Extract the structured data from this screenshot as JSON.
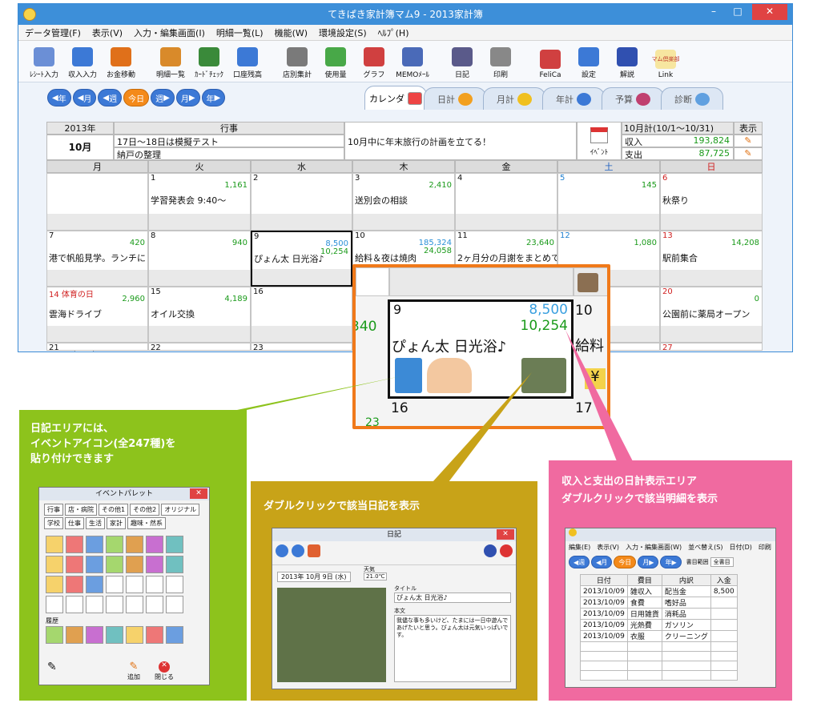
{
  "window": {
    "title": "てきぱき家計簿マム9 - 2013家計簿",
    "min": "–",
    "max": "□",
    "close": "✕"
  },
  "menu": [
    "データ管理(F)",
    "表示(V)",
    "入力・編集画面(I)",
    "明細一覧(L)",
    "機能(W)",
    "環境設定(S)",
    "ﾍﾙﾌﾟ(H)"
  ],
  "toolbar": [
    {
      "label": "ﾚｼｰﾄ入力",
      "icon": "receipt-icon",
      "color": "#6b8fd6"
    },
    {
      "label": "収入入力",
      "icon": "income-icon",
      "color": "#3c79d6"
    },
    {
      "label": "お金移動",
      "icon": "money-move-icon",
      "color": "#e0701a"
    },
    {
      "label": "明細一覧",
      "icon": "list-icon",
      "color": "#d98a2a"
    },
    {
      "label": "ｶｰﾄﾞﾁｪｯｸ",
      "icon": "card-icon",
      "color": "#3a8a3a"
    },
    {
      "label": "口座残高",
      "icon": "bank-icon",
      "color": "#3c79d6"
    },
    {
      "label": "店別集計",
      "icon": "shop-icon",
      "color": "#7a7a7a"
    },
    {
      "label": "使用量",
      "icon": "usage-icon",
      "color": "#48a848"
    },
    {
      "label": "グラフ",
      "icon": "graph-icon",
      "color": "#d04040"
    },
    {
      "label": "MEMOﾒｰﾙ",
      "icon": "memo-icon",
      "color": "#4a6ab8"
    },
    {
      "label": "日記",
      "icon": "diary-icon",
      "color": "#5a5a8a"
    },
    {
      "label": "印刷",
      "icon": "print-icon",
      "color": "#888888"
    },
    {
      "label": "FeliCa",
      "icon": "felica-icon",
      "color": "#d04040"
    },
    {
      "label": "設定",
      "icon": "settings-icon",
      "color": "#3c79d6"
    },
    {
      "label": "解説",
      "icon": "help-icon",
      "color": "#3050b0"
    },
    {
      "label": "Link",
      "icon": "link-icon",
      "color": "#c09020"
    }
  ],
  "toolbar_link_logo": "マム倶楽部",
  "nav": {
    "year_prev": "年",
    "month_prev": "月",
    "week_prev": "週",
    "today": "今日",
    "week_next": "週",
    "month_next": "月",
    "year_next": "年"
  },
  "view_tabs": [
    "カレンダ",
    "日計",
    "月計",
    "年計",
    "予算",
    "診断"
  ],
  "header": {
    "year": "2013年",
    "month": "10月",
    "events_title": "行事",
    "event1": "17日〜18日は模擬テスト",
    "event2": "納戸の整理",
    "memo": "10月中に年末旅行の計画を立てる！",
    "event_button": "ｲﾍﾞﾝﾄ",
    "summary_title": "10月計(10/1〜10/31)",
    "display_label": "表示",
    "income_label": "収入",
    "income_value": "193,824",
    "expense_label": "支出",
    "expense_value": "87,725"
  },
  "weekdays": [
    "月",
    "火",
    "水",
    "木",
    "金",
    "土",
    "日"
  ],
  "weeks": [
    [
      {
        "num": "",
        "a1": "",
        "a2": "",
        "ev": ""
      },
      {
        "num": "1",
        "a1": "1,161",
        "a2": "",
        "ev": "学習発表会 9:40〜"
      },
      {
        "num": "2",
        "a1": "",
        "a2": "",
        "ev": ""
      },
      {
        "num": "3",
        "a1": "2,410",
        "a2": "",
        "ev": "送別会の相談"
      },
      {
        "num": "4",
        "a1": "",
        "a2": "",
        "ev": ""
      },
      {
        "num": "5",
        "a1": "145",
        "a2": "",
        "ev": ""
      },
      {
        "num": "6",
        "a1": "",
        "a2": "",
        "ev": "秋祭り"
      }
    ],
    [
      {
        "num": "7",
        "a1": "420",
        "a2": "",
        "ev": "港で帆船見学。ランチに"
      },
      {
        "num": "8",
        "a1": "940",
        "a2": "",
        "ev": ""
      },
      {
        "num": "9",
        "a1": "8,500",
        "a2": "10,254",
        "ev": "ぴょん太 日光浴♪"
      },
      {
        "num": "10",
        "a1": "185,324",
        "a2": "24,058",
        "ev": "給料＆夜は焼肉"
      },
      {
        "num": "11",
        "a1": "23,640",
        "a2": "",
        "ev": "2ヶ月分の月謝をまとめて"
      },
      {
        "num": "12",
        "a1": "1,080",
        "a2": "",
        "ev": ""
      },
      {
        "num": "13",
        "a1": "14,208",
        "a2": "",
        "ev": "駅前集合"
      }
    ],
    [
      {
        "num": "14 体育の日",
        "a1": "2,960",
        "a2": "",
        "ev": "雲海ドライブ"
      },
      {
        "num": "15",
        "a1": "4,189",
        "a2": "",
        "ev": "オイル交換"
      },
      {
        "num": "16",
        "a1": "",
        "a2": "",
        "ev": ""
      },
      {
        "num": "17",
        "a1": "",
        "a2": "",
        "ev": ""
      },
      {
        "num": "",
        "a1": "",
        "a2": "",
        "ev": ""
      },
      {
        "num": "",
        "a1": "",
        "a2": "",
        "ev": ""
      },
      {
        "num": "20",
        "a1": "0",
        "a2": "",
        "ev": "公園前に薬局オープン"
      }
    ],
    [
      {
        "num": "21"
      },
      {
        "num": "22"
      },
      {
        "num": "23"
      },
      {
        "num": ""
      },
      {
        "num": ""
      },
      {
        "num": ""
      },
      {
        "num": "27"
      }
    ]
  ],
  "zoom": {
    "day": "9",
    "left_num": "340",
    "v1": "8,500",
    "v2": "10,254",
    "ev": "ぴょん太 日光浴♪",
    "next_day": "10",
    "next_ev": "給料",
    "yen": "¥",
    "below_day": "16",
    "below_right": "17",
    "bottom_left": "23"
  },
  "callouts": {
    "green": "日記エリアには、\nイベントアイコン(全247種)を\n貼り付けできます",
    "olive": "ダブルクリックで該当日記を表示",
    "pink": "収入と支出の日計表示エリア\nダブルクリックで該当明細を表示"
  },
  "palette": {
    "title": "イベントパレット",
    "tabs": [
      "行事",
      "店・病院",
      "その他1",
      "その他2",
      "オリジナル",
      "学校",
      "仕事",
      "生活",
      "家計",
      "趣味・然系"
    ],
    "history": "履歴",
    "add": "追加",
    "close": "閉じる"
  },
  "diary": {
    "title": "日記",
    "date": "2013年 10月 9日 (水)",
    "weather": "天気",
    "temp": "21.0℃",
    "titlefield_label": "タイトル",
    "titlefield": "ぴょん太 日光浴♪",
    "body_label": "本文",
    "body": "我儘な事も多いけど、たまには一日中遊んであげたいと思う。ぴょん太は元気いっぱいです。"
  },
  "ledger": {
    "menu": [
      "編集(E)",
      "表示(V)",
      "入力・編集画面(W)",
      "並べ替え(S)",
      "日付(D)",
      "印刷"
    ],
    "period_label": "書目範囲",
    "period_value": "全書目",
    "columns": [
      "日付",
      "費目",
      "内訳",
      "入金"
    ],
    "rows": [
      [
        "2013/10/09",
        "雑収入",
        "配当金",
        "8,500"
      ],
      [
        "2013/10/09",
        "食費",
        "嗜好品",
        ""
      ],
      [
        "2013/10/09",
        "日用雑貨",
        "消耗品",
        ""
      ],
      [
        "2013/10/09",
        "光熱費",
        "ガソリン",
        ""
      ],
      [
        "2013/10/09",
        "衣服",
        "クリーニング",
        ""
      ]
    ]
  }
}
